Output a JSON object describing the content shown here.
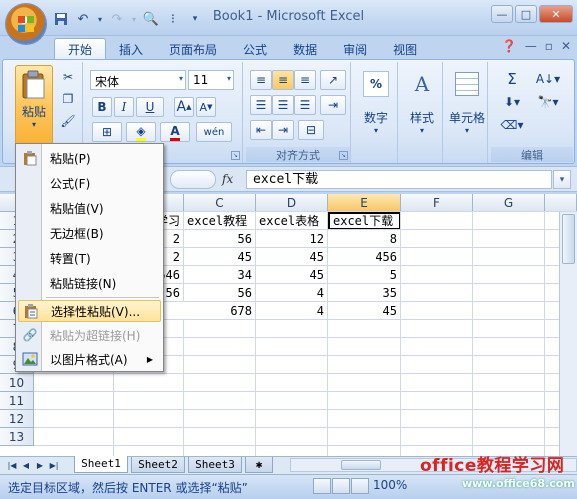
{
  "window": {
    "title": "Book1 - Microsoft Excel",
    "controls": [
      "—",
      "□",
      "✕"
    ]
  },
  "ribbon_tabs": [
    "开始",
    "插入",
    "页面布局",
    "公式",
    "数据",
    "审阅",
    "视图"
  ],
  "active_tab": "开始",
  "ribbon": {
    "paste_label": "粘贴",
    "font_name": "宋体",
    "font_size": "11",
    "bold": "B",
    "italic": "I",
    "underline": "U",
    "align_group_label": "对齐方式",
    "number_label": "数字",
    "number_pct": "%",
    "style_label": "样式",
    "cells_label": "单元格",
    "edit_label": "编辑",
    "sigma": "Σ"
  },
  "formula_bar": {
    "fx": "fx",
    "value": "excel下载"
  },
  "grid": {
    "columns": [
      "C",
      "D",
      "E",
      "F",
      "G"
    ],
    "selected_column": "E",
    "rows": [
      "2",
      "3",
      "4",
      "5",
      "6",
      "7",
      "8",
      "9",
      "10",
      "11",
      "12",
      "13"
    ],
    "partial_b": [
      "学习",
      "2",
      "2",
      "546",
      "56"
    ],
    "data": [
      [
        "excel教程",
        "excel表格",
        "excel下载"
      ],
      [
        "56",
        "12",
        "8"
      ],
      [
        "45",
        "45",
        "456"
      ],
      [
        "34",
        "45",
        "5"
      ],
      [
        "56",
        "4",
        "35"
      ],
      [
        "678",
        "4",
        "45"
      ]
    ]
  },
  "context_menu": {
    "items": [
      {
        "label": "粘贴(P)",
        "icon": "paste-icon",
        "enabled": true
      },
      {
        "label": "公式(F)",
        "icon": "",
        "enabled": true
      },
      {
        "label": "粘贴值(V)",
        "icon": "",
        "enabled": true
      },
      {
        "label": "无边框(B)",
        "icon": "",
        "enabled": true
      },
      {
        "label": "转置(T)",
        "icon": "",
        "enabled": true
      },
      {
        "label": "粘贴链接(N)",
        "icon": "",
        "enabled": true
      },
      {
        "label": "选择性粘贴(V)...",
        "icon": "paste-special-icon",
        "enabled": true,
        "highlighted": true
      },
      {
        "label": "粘贴为超链接(H)",
        "icon": "hyperlink-icon",
        "enabled": false
      },
      {
        "label": "以图片格式(A)",
        "icon": "picture-icon",
        "enabled": true,
        "submenu": true
      }
    ]
  },
  "sheets": [
    "Sheet1",
    "Sheet2",
    "Sheet3"
  ],
  "active_sheet": "Sheet1",
  "status": {
    "text": "选定目标区域，然后按 ENTER 或选择“粘贴”",
    "zoom": "100%"
  },
  "watermark": {
    "line1": "office教程学习网",
    "line2": "www.office68.com"
  }
}
